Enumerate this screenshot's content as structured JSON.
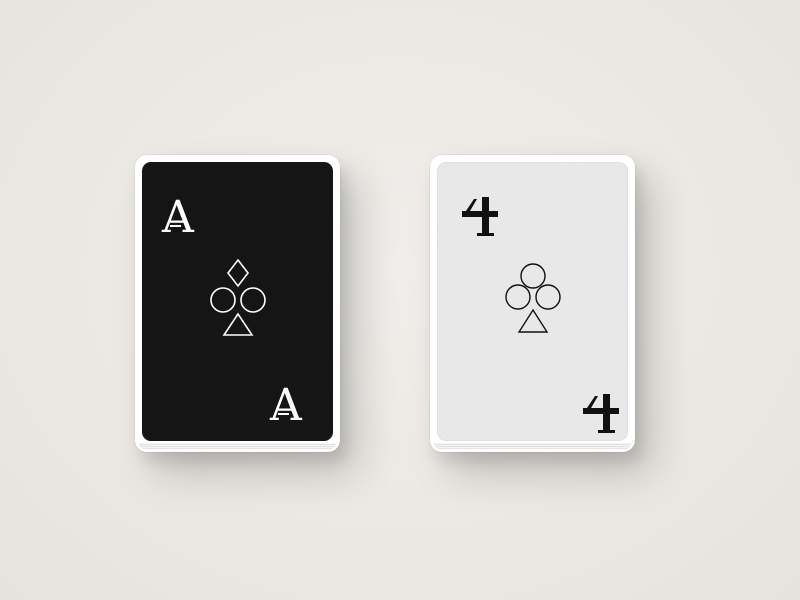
{
  "scene": {
    "background_color": "#ebe8e3"
  },
  "cards": [
    {
      "name": "ace-card",
      "face_color": "#141414",
      "ink_color": "#ffffff",
      "corner_text": "A"
    },
    {
      "name": "four-card",
      "face_color": "#e9e9e9",
      "ink_color": "#111111",
      "corner_glyph": "four-symbol-icon"
    }
  ],
  "emblem": {
    "shapes": [
      "diamond-icon",
      "circle-icon",
      "circle-icon",
      "triangle-icon"
    ]
  }
}
